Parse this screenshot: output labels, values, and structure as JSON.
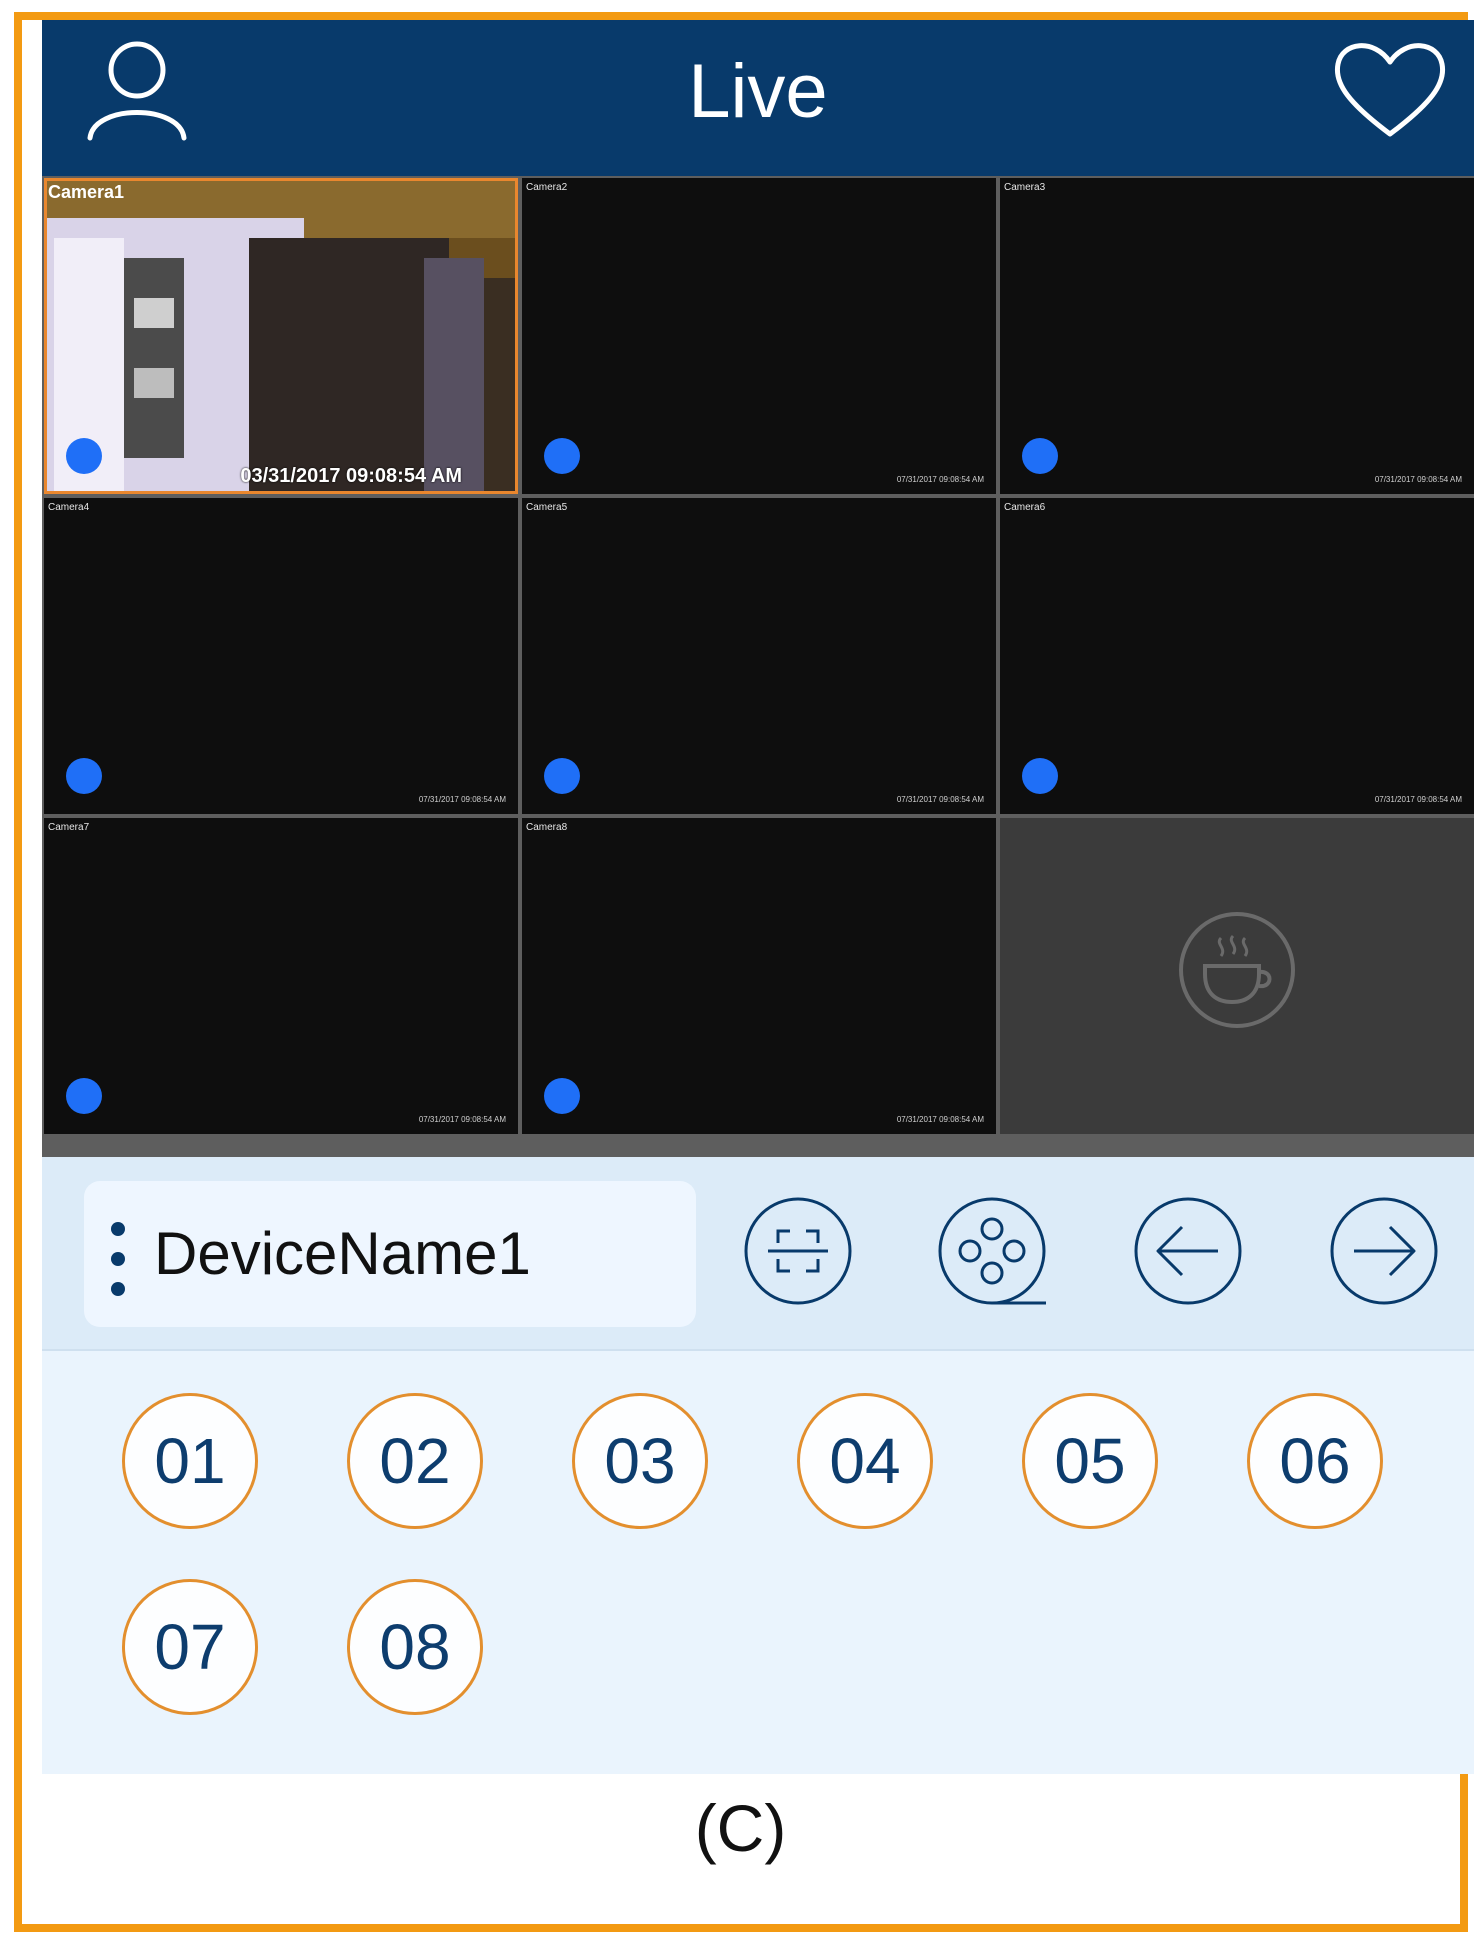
{
  "header": {
    "title": "Live",
    "left_icon": "user-icon",
    "right_icon": "heart-icon"
  },
  "cameras": [
    {
      "name": "Camera1",
      "timestamp": "03/31/2017 09:08:54 AM",
      "status": "live"
    },
    {
      "name": "Camera2",
      "timestamp": "07/31/2017 09:08:54 AM",
      "status": "no-signal"
    },
    {
      "name": "Camera3",
      "timestamp": "07/31/2017 09:08:54 AM",
      "status": "no-signal"
    },
    {
      "name": "Camera4",
      "timestamp": "07/31/2017 09:08:54 AM",
      "status": "no-signal"
    },
    {
      "name": "Camera5",
      "timestamp": "07/31/2017 09:08:54 AM",
      "status": "no-signal"
    },
    {
      "name": "Camera6",
      "timestamp": "07/31/2017 09:08:54 AM",
      "status": "no-signal"
    },
    {
      "name": "Camera7",
      "timestamp": "07/31/2017 09:08:54 AM",
      "status": "no-signal"
    },
    {
      "name": "Camera8",
      "timestamp": "07/31/2017 09:08:54 AM",
      "status": "no-signal"
    }
  ],
  "empty_slot_icon": "coffee-cup-icon",
  "toolbar": {
    "device_name": "DeviceName1",
    "tools": [
      "fullscreen-icon",
      "film-reel-icon",
      "previous-arrow-icon",
      "next-arrow-icon"
    ]
  },
  "channels": [
    "01",
    "02",
    "03",
    "04",
    "05",
    "06",
    "07",
    "08"
  ],
  "caption": "(C)",
  "colors": {
    "header_bg": "#083a6b",
    "accent_orange": "#e38f2e",
    "record_dot": "#1f6ff7",
    "toolbar_bg": "#dcebf8"
  }
}
